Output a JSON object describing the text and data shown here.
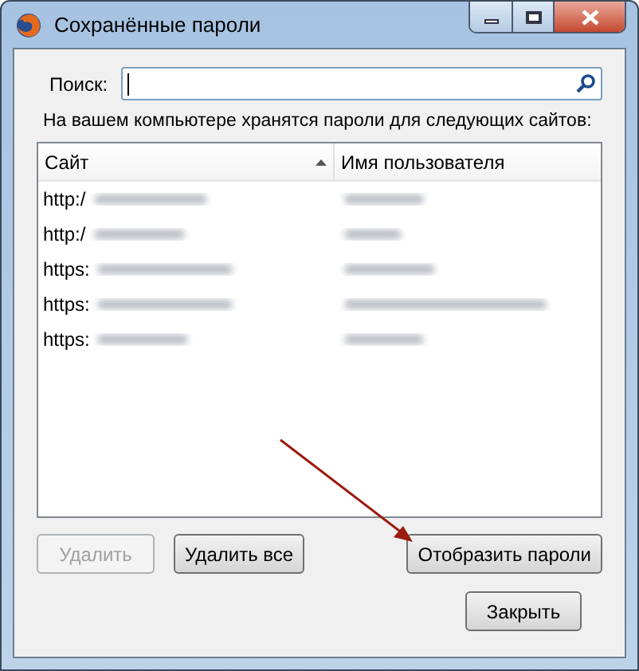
{
  "window": {
    "title": "Сохранённые пароли"
  },
  "search": {
    "label": "Поиск:"
  },
  "description": "На вашем компьютере хранятся пароли для следующих сайтов:",
  "table": {
    "columns": [
      {
        "label": "Сайт",
        "sorted": true
      },
      {
        "label": "Имя пользователя",
        "sorted": false
      }
    ],
    "rows": [
      {
        "site": "http:/"
      },
      {
        "site": "http:/"
      },
      {
        "site": "https:"
      },
      {
        "site": "https:"
      },
      {
        "site": "https:"
      }
    ]
  },
  "buttons": [
    {
      "label": "Удалить",
      "disabled": true
    },
    {
      "label": "Удалить все",
      "disabled": false
    },
    {
      "label": "Отобразить пароли",
      "disabled": false
    }
  ],
  "close_button": {
    "label": "Закрыть"
  }
}
